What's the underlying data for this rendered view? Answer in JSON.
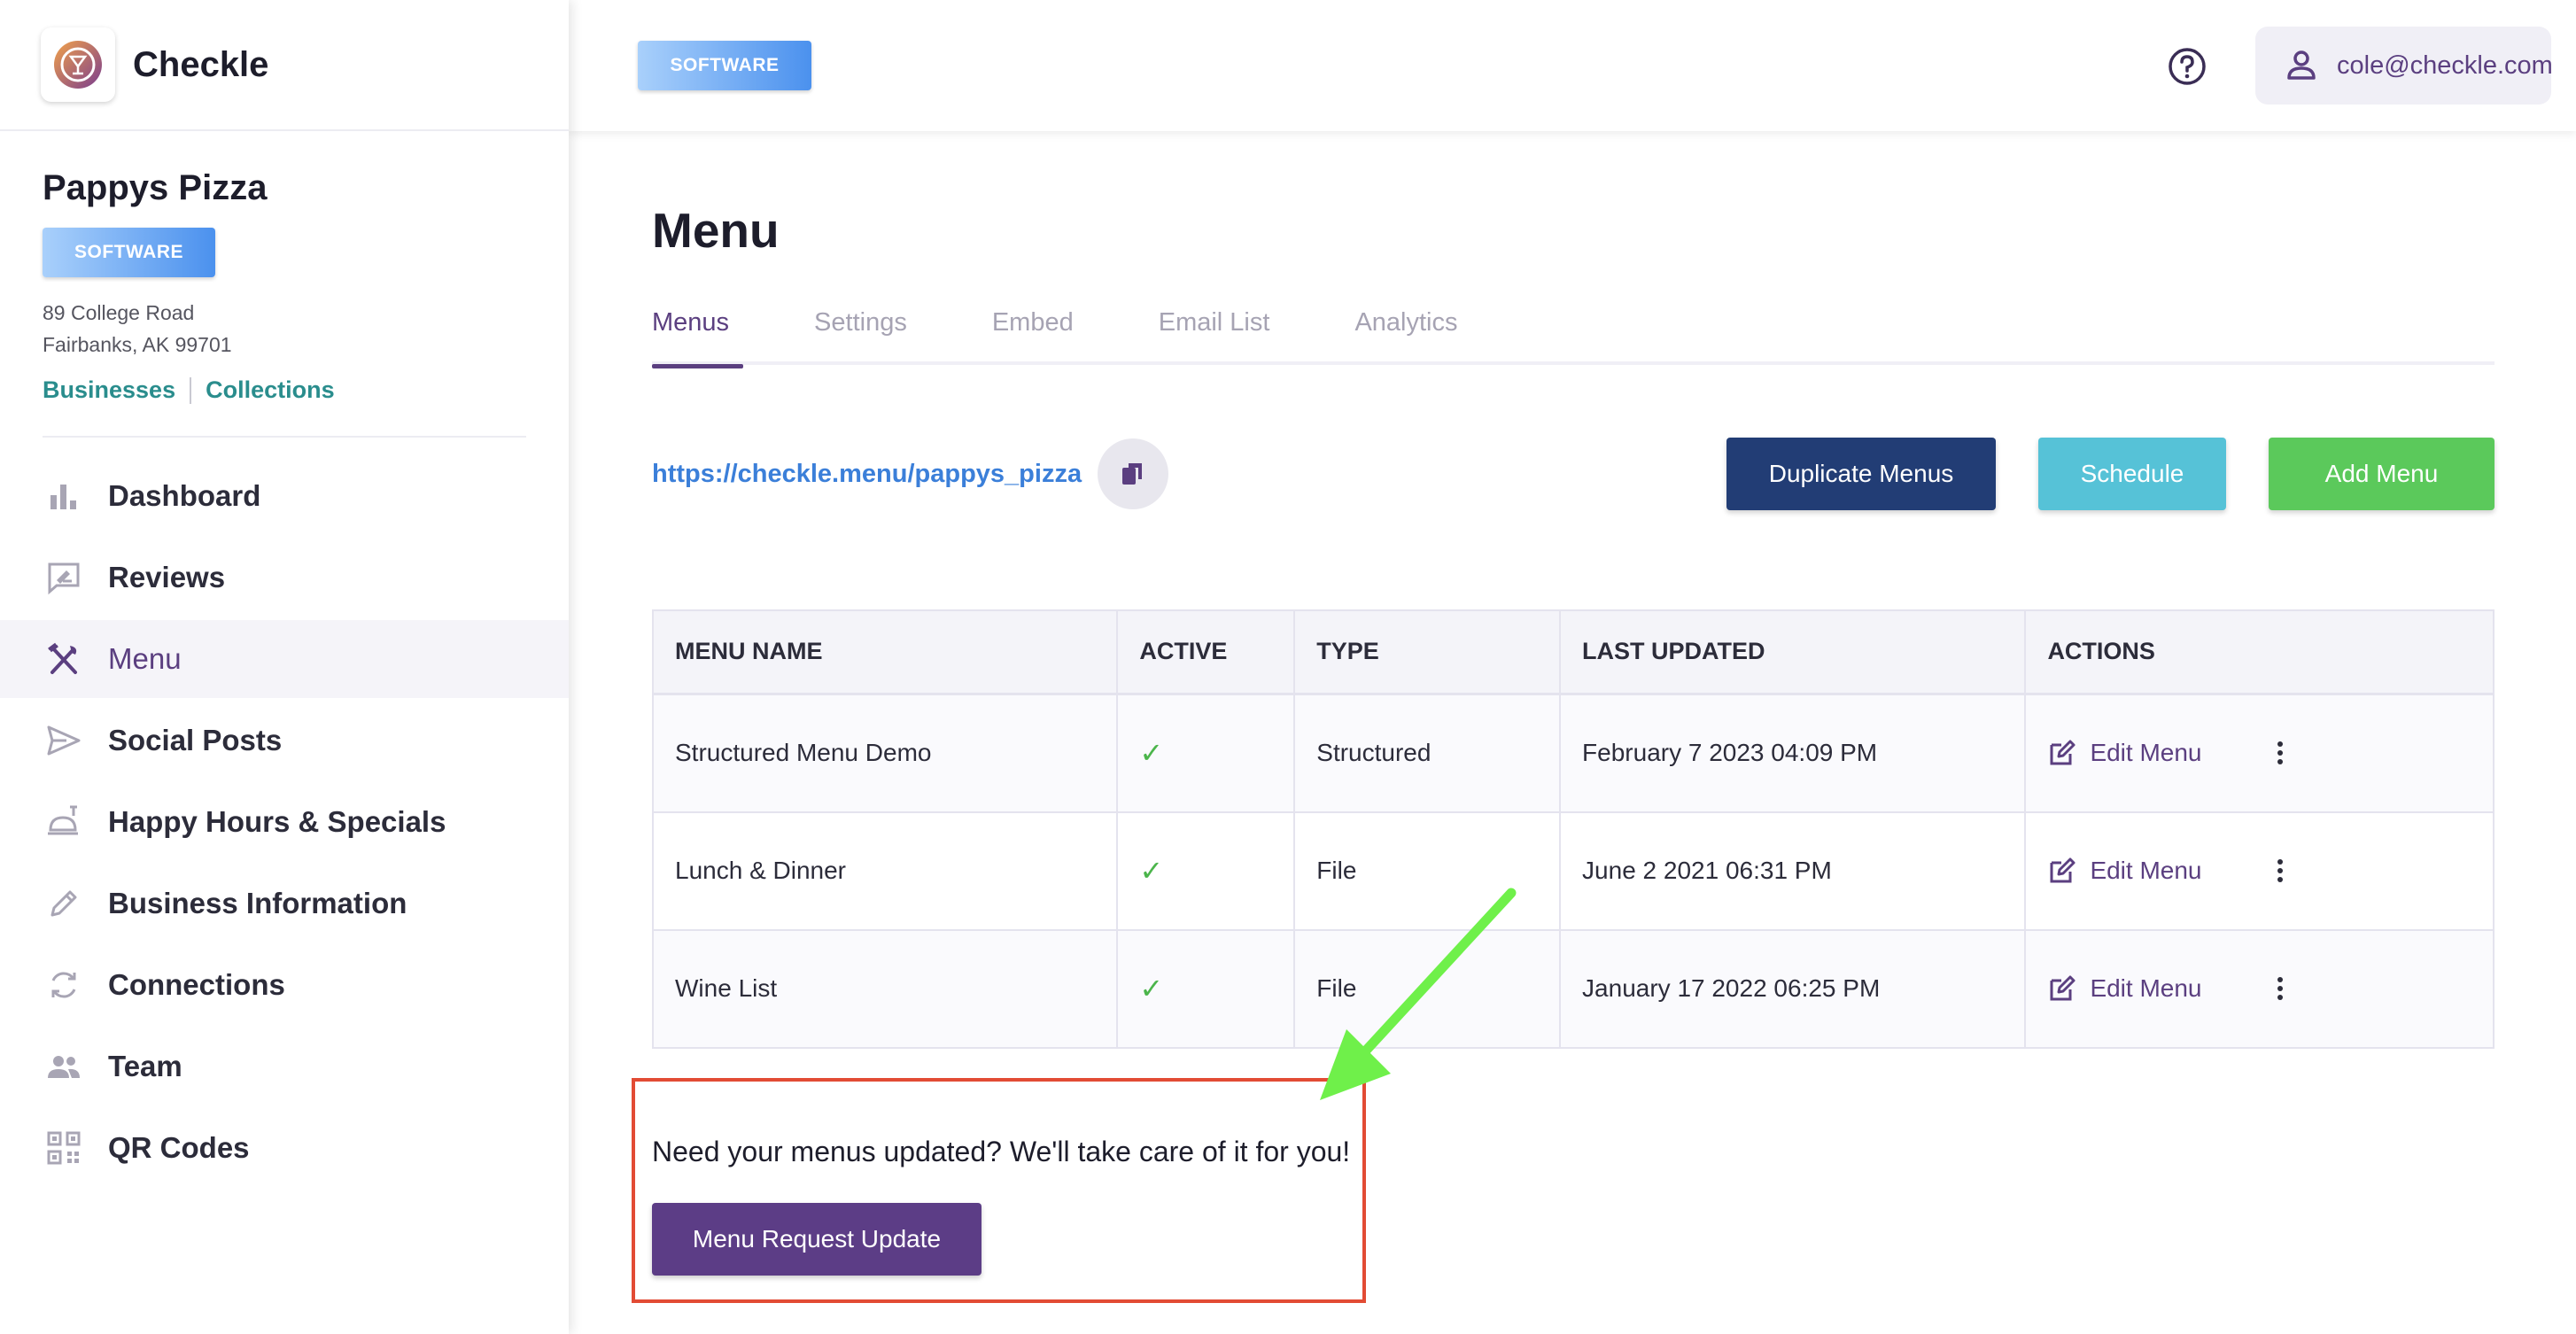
{
  "brand": {
    "name": "Checkle"
  },
  "business": {
    "name": "Pappys Pizza",
    "badge": "SOFTWARE",
    "address_line1": "89 College Road",
    "address_line2": "Fairbanks, AK 99701",
    "links": [
      "Businesses",
      "Collections"
    ]
  },
  "sidebar": {
    "items": [
      {
        "label": "Dashboard",
        "icon": "bar-chart-icon"
      },
      {
        "label": "Reviews",
        "icon": "review-icon"
      },
      {
        "label": "Menu",
        "icon": "utensils-icon",
        "active": true
      },
      {
        "label": "Social Posts",
        "icon": "send-icon"
      },
      {
        "label": "Happy Hours & Specials",
        "icon": "food-tray-icon"
      },
      {
        "label": "Business Information",
        "icon": "pencil-icon"
      },
      {
        "label": "Connections",
        "icon": "sync-icon"
      },
      {
        "label": "Team",
        "icon": "team-icon"
      },
      {
        "label": "QR Codes",
        "icon": "qr-code-icon"
      }
    ]
  },
  "header": {
    "badge": "SOFTWARE",
    "user_email": "cole@checkle.com"
  },
  "main": {
    "title": "Menu",
    "tabs": [
      "Menus",
      "Settings",
      "Embed",
      "Email List",
      "Analytics"
    ],
    "active_tab": "Menus",
    "menu_url": "https://checkle.menu/pappys_pizza",
    "buttons": {
      "duplicate": "Duplicate Menus",
      "schedule": "Schedule",
      "add": "Add Menu"
    },
    "table": {
      "headers": [
        "MENU NAME",
        "ACTIVE",
        "TYPE",
        "LAST UPDATED",
        "ACTIONS"
      ],
      "rows": [
        {
          "name": "Structured Menu Demo",
          "active": "✓",
          "type": "Structured",
          "updated": "February 7 2023 04:09 PM",
          "action": "Edit Menu"
        },
        {
          "name": "Lunch & Dinner",
          "active": "✓",
          "type": "File",
          "updated": "June 2 2021 06:31 PM",
          "action": "Edit Menu"
        },
        {
          "name": "Wine List",
          "active": "✓",
          "type": "File",
          "updated": "January 17 2022 06:25 PM",
          "action": "Edit Menu"
        }
      ]
    },
    "update_prompt": "Need your menus updated? We'll take care of it for you!",
    "request_button": "Menu Request Update"
  },
  "colors": {
    "accent_purple": "#5b3f80",
    "link_teal": "#2a8d8d",
    "duplicate_button": "#223d75",
    "schedule_button": "#56c2d7",
    "add_button": "#5bc95b",
    "highlight_box": "#e24b34",
    "annotation_arrow": "#6ff04a"
  }
}
